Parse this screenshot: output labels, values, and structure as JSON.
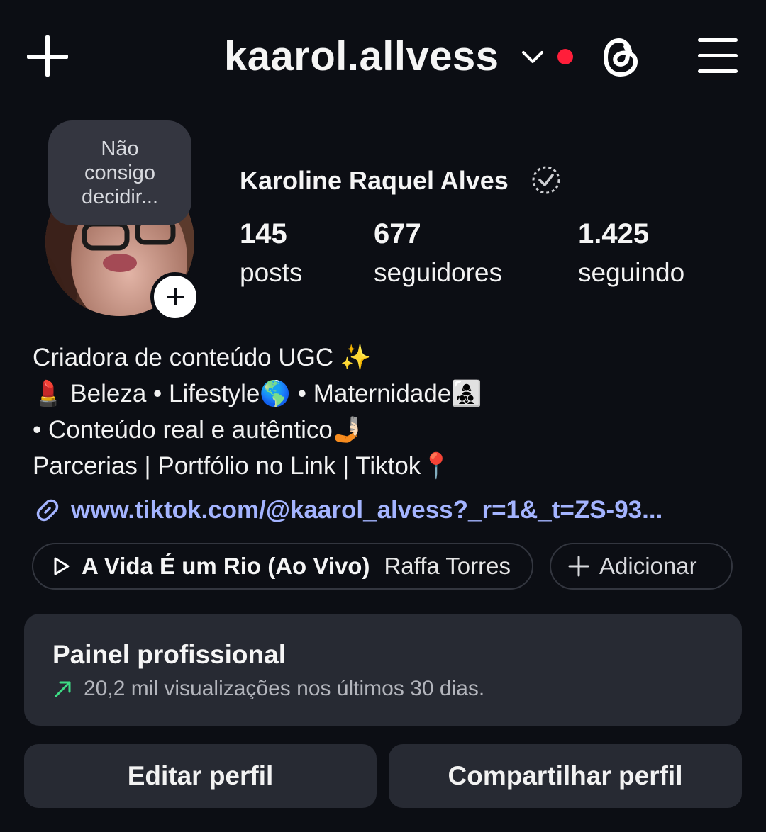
{
  "header": {
    "username": "kaarol.allvess",
    "icons": [
      "plus-icon",
      "chevron-down-icon",
      "notification-dot",
      "threads-icon",
      "menu-icon"
    ],
    "notification_color": "#ff1e3a"
  },
  "profile": {
    "note": "Não\nconsigo\ndecidir...",
    "full_name": "Karoline Raquel Alves",
    "stats": [
      {
        "value": "145",
        "label": "posts"
      },
      {
        "value": "677",
        "label": "seguidores"
      },
      {
        "value": "1.425",
        "label": "seguindo"
      }
    ]
  },
  "bio": {
    "lines": [
      "Criadora de conteúdo UGC ✨",
      "💄 Beleza • Lifestyle🌎 • Maternidade👩‍👧‍👦",
      "• Conteúdo real e autêntico🤳🏻",
      "Parcerias | Portfólio no Link | Tiktok📍"
    ],
    "link": "www.tiktok.com/@kaarol_alvess?_r=1&_t=ZS-93...",
    "link_color": "#a4b4ff"
  },
  "music": {
    "song": "A Vida É um Rio (Ao Vivo)",
    "artist": "Raffa Torres",
    "add_label": "Adicionar"
  },
  "panel": {
    "title": "Painel profissional",
    "subtitle": "20,2 mil visualizações nos últimos 30 dias.",
    "trend_color": "#3ddc84"
  },
  "buttons": {
    "edit": "Editar perfil",
    "share": "Compartilhar perfil"
  }
}
